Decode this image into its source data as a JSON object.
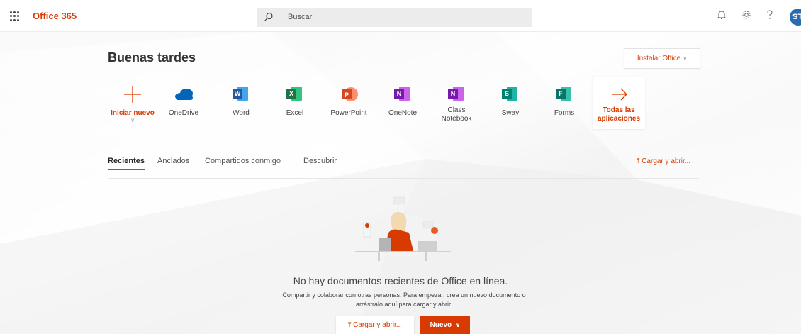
{
  "header": {
    "brand": "Office 365",
    "search_placeholder": "Buscar",
    "avatar_initials": "ST"
  },
  "greeting": "Buenas tardes",
  "install_label": "Instalar Office",
  "apps": [
    {
      "label": "Iniciar nuevo",
      "icon": "plus-icon"
    },
    {
      "label": "OneDrive",
      "icon": "onedrive-icon"
    },
    {
      "label": "Word",
      "icon": "word-icon",
      "letter": "W",
      "color": "#2b579a"
    },
    {
      "label": "Excel",
      "icon": "excel-icon",
      "letter": "X",
      "color": "#217346"
    },
    {
      "label": "PowerPoint",
      "icon": "powerpoint-icon",
      "letter": "P",
      "color": "#d24726"
    },
    {
      "label": "OneNote",
      "icon": "onenote-icon",
      "letter": "N",
      "color": "#7719aa"
    },
    {
      "label": "Class Notebook",
      "label_lines": [
        "Class",
        "Notebook"
      ],
      "icon": "class-notebook-icon",
      "letter": "N",
      "color": "#7719aa"
    },
    {
      "label": "Sway",
      "icon": "sway-icon",
      "letter": "S",
      "color": "#008272"
    },
    {
      "label": "Forms",
      "icon": "forms-icon",
      "letter": "F",
      "color": "#077568"
    },
    {
      "label": "Todas las aplicaciones",
      "label_lines": [
        "Todas las",
        "aplicaciones"
      ],
      "icon": "arrow-right-icon"
    }
  ],
  "tabs": [
    {
      "label": "Recientes",
      "active": true
    },
    {
      "label": "Anclados",
      "active": false
    },
    {
      "label": "Compartidos conmigo",
      "active": false
    },
    {
      "label": "Descubrir",
      "active": false
    }
  ],
  "upload_label": "Cargar y abrir...",
  "empty_state": {
    "title": "No hay documentos recientes de Office en línea.",
    "line1": "Compartir y colaborar con otras personas. Para empezar, crea un nuevo documento o",
    "line2": "arrástralo aquí para cargar y abrir.",
    "upload_button": "Cargar y abrir...",
    "new_button": "Nuevo"
  },
  "colors": {
    "accent": "#d83b01",
    "onedrive": "#0364b8"
  }
}
